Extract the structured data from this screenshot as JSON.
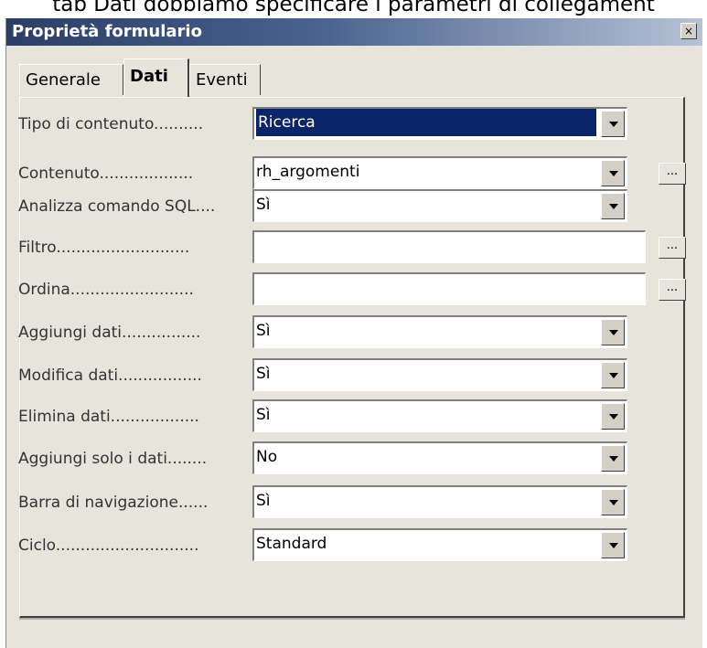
{
  "caption": "tab Dati dobbiamo specificare i parametri di collegament",
  "window": {
    "title": "Proprietà formulario",
    "close_label": "×"
  },
  "tabs": [
    {
      "label": "Generale",
      "active": false
    },
    {
      "label": "Dati",
      "active": true
    },
    {
      "label": "Eventi",
      "active": false
    }
  ],
  "rows": [
    {
      "label": "Tipo di contenuto..........",
      "value": "Ricerca",
      "kind": "select",
      "selected": true
    },
    {
      "label": "Contenuto...................",
      "value": "rh_argomenti",
      "kind": "select",
      "ellipsis": true
    },
    {
      "label": "Analizza comando SQL....",
      "value": "Sì",
      "kind": "select"
    },
    {
      "label": "Filtro...........................",
      "value": "",
      "kind": "text",
      "ellipsis": true
    },
    {
      "label": "Ordina.........................",
      "value": "",
      "kind": "text",
      "ellipsis": true
    },
    {
      "label": "Aggiungi dati................",
      "value": "Sì",
      "kind": "select"
    },
    {
      "label": "Modifica dati.................",
      "value": "Sì",
      "kind": "select"
    },
    {
      "label": "Elimina dati..................",
      "value": "Sì",
      "kind": "select"
    },
    {
      "label": "Aggiungi solo i dati........",
      "value": "No",
      "kind": "select"
    },
    {
      "label": "Barra di navigazione......",
      "value": "Sì",
      "kind": "select"
    },
    {
      "label": "Ciclo.............................",
      "value": "Standard",
      "kind": "select"
    }
  ],
  "ellipsis_label": "..."
}
